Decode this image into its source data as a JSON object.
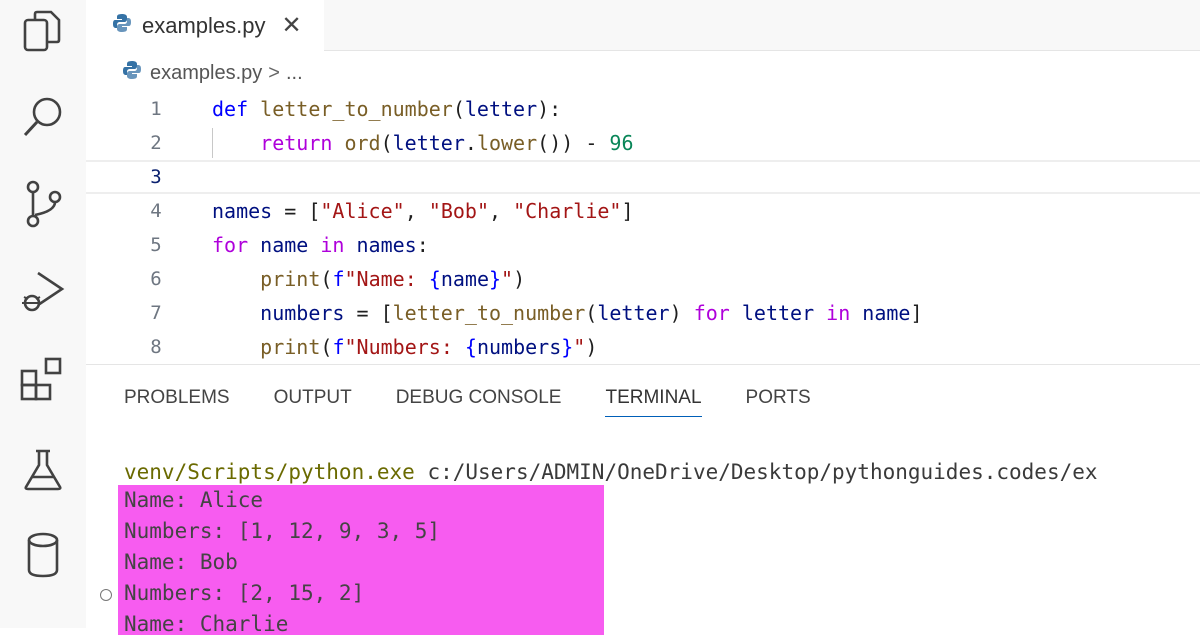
{
  "activity_bar": {
    "items": [
      {
        "icon": "explorer-icon"
      },
      {
        "icon": "search-icon"
      },
      {
        "icon": "source-control-icon"
      },
      {
        "icon": "run-debug-icon"
      },
      {
        "icon": "extensions-icon"
      },
      {
        "icon": "testing-icon"
      },
      {
        "icon": "database-icon"
      }
    ]
  },
  "tab": {
    "label": "examples.py",
    "close": "✕",
    "icon": "python-icon"
  },
  "breadcrumb": {
    "file": "examples.py",
    "separator": ">",
    "ellipsis": "..."
  },
  "editor": {
    "current_line": 3,
    "lines": [
      {
        "number": "1"
      },
      {
        "number": "2"
      },
      {
        "number": "3"
      },
      {
        "number": "4"
      },
      {
        "number": "5"
      },
      {
        "number": "6"
      },
      {
        "number": "7"
      },
      {
        "number": "8"
      }
    ],
    "tokens": {
      "l1_def": "def ",
      "l1_fn": "letter_to_number",
      "l1_open": "(",
      "l1_param": "letter",
      "l1_close": "):",
      "l2_ret": "return ",
      "l2_ord": "ord",
      "l2_a": "(",
      "l2_var": "letter",
      "l2_dot": ".",
      "l2_lower": "lower",
      "l2_b": "()) - ",
      "l2_num": "96",
      "l4_var": "names",
      "l4_eq": " = [",
      "l4_s1": "\"Alice\"",
      "l4_c1": ", ",
      "l4_s2": "\"Bob\"",
      "l4_c2": ", ",
      "l4_s3": "\"Charlie\"",
      "l4_end": "]",
      "l5_for": "for ",
      "l5_var": "name ",
      "l5_in": "in ",
      "l5_names": "names",
      "l5_colon": ":",
      "l6_print": "print",
      "l6_open": "(",
      "l6_f": "f",
      "l6_str1": "\"Name: ",
      "l6_brace_o": "{",
      "l6_var": "name",
      "l6_brace_c": "}",
      "l6_str2": "\"",
      "l6_close": ")",
      "l7_var": "numbers",
      "l7_eq": " = [",
      "l7_fn": "letter_to_number",
      "l7_open": "(",
      "l7_arg": "letter",
      "l7_close": ") ",
      "l7_for": "for ",
      "l7_letter": "letter ",
      "l7_in": "in ",
      "l7_name": "name",
      "l7_end": "]",
      "l8_print": "print",
      "l8_open": "(",
      "l8_f": "f",
      "l8_str1": "\"Numbers: ",
      "l8_brace_o": "{",
      "l8_var": "numbers",
      "l8_brace_c": "}",
      "l8_str2": "\"",
      "l8_close": ")"
    }
  },
  "panel": {
    "tabs": [
      {
        "label": "PROBLEMS"
      },
      {
        "label": "OUTPUT"
      },
      {
        "label": "DEBUG CONSOLE"
      },
      {
        "label": "TERMINAL",
        "active": true
      },
      {
        "label": "PORTS"
      }
    ]
  },
  "terminal": {
    "cmd_python": "venv/Scripts/python.exe",
    "cmd_path": " c:/Users/ADMIN/OneDrive/Desktop/pythonguides.codes/ex",
    "output": [
      "Name: Alice",
      "Numbers: [1, 12, 9, 3, 5]",
      "Name: Bob",
      "Numbers: [2, 15, 2]",
      "Name: Charlie"
    ],
    "highlight_color": "#f75cf0"
  },
  "colors": {
    "keyword": "#0000ff",
    "control": "#af00db",
    "function": "#795e26",
    "variable": "#001080",
    "string": "#a31515",
    "number": "#098658"
  }
}
